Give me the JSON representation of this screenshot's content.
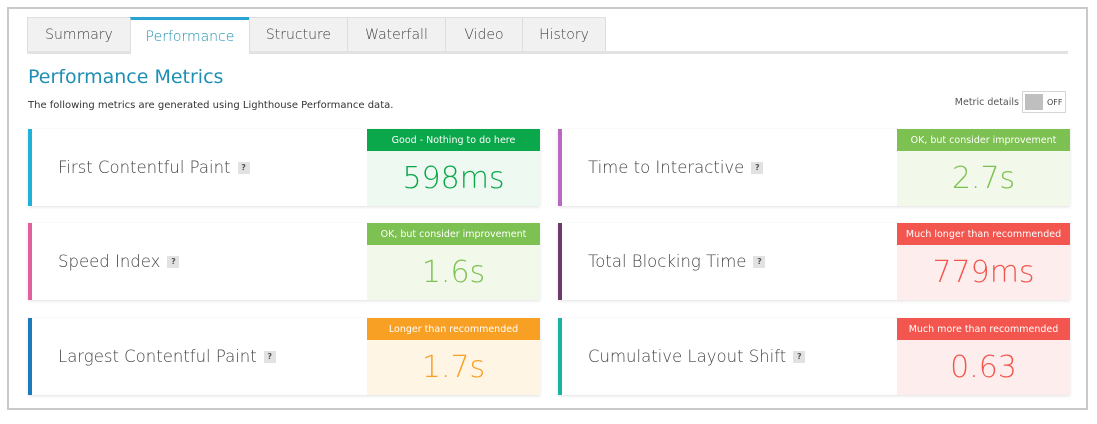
{
  "tabs": [
    {
      "label": "Summary",
      "active": false
    },
    {
      "label": "Performance",
      "active": true
    },
    {
      "label": "Structure",
      "active": false
    },
    {
      "label": "Waterfall",
      "active": false
    },
    {
      "label": "Video",
      "active": false
    },
    {
      "label": "History",
      "active": false
    }
  ],
  "header": {
    "title": "Performance Metrics",
    "subtitle": "The following metrics are generated using Lighthouse Performance data."
  },
  "metric_details": {
    "label": "Metric details",
    "state": "OFF"
  },
  "help_glyph": "?",
  "metrics": [
    {
      "name": "First Contentful Paint",
      "value": "598ms",
      "grade": "Good - Nothing to do here",
      "bar_color": "#1fb1d8",
      "grade_color": "#0aa84b",
      "value_color": "#0aa84b",
      "value_bg": "#eef9f1"
    },
    {
      "name": "Time to Interactive",
      "value": "2.7s",
      "grade": "OK, but consider improvement",
      "bar_color": "#b86ac2",
      "grade_color": "#7cc151",
      "value_color": "#7cc151",
      "value_bg": "#f2f9ea"
    },
    {
      "name": "Speed Index",
      "value": "1.6s",
      "grade": "OK, but consider improvement",
      "bar_color": "#e2609b",
      "grade_color": "#7cc151",
      "value_color": "#7cc151",
      "value_bg": "#f2f9ea"
    },
    {
      "name": "Total Blocking Time",
      "value": "779ms",
      "grade": "Much longer than recommended",
      "bar_color": "#6e3a6a",
      "grade_color": "#f2564f",
      "value_color": "#f2564f",
      "value_bg": "#fdeeed"
    },
    {
      "name": "Largest Contentful Paint",
      "value": "1.7s",
      "grade": "Longer than recommended",
      "bar_color": "#1c7bbd",
      "grade_color": "#f7a024",
      "value_color": "#f7a024",
      "value_bg": "#fff5e5"
    },
    {
      "name": "Cumulative Layout Shift",
      "value": "0.63",
      "grade": "Much more than recommended",
      "bar_color": "#17b3a4",
      "grade_color": "#f2564f",
      "value_color": "#f2564f",
      "value_bg": "#fdeeed"
    }
  ]
}
